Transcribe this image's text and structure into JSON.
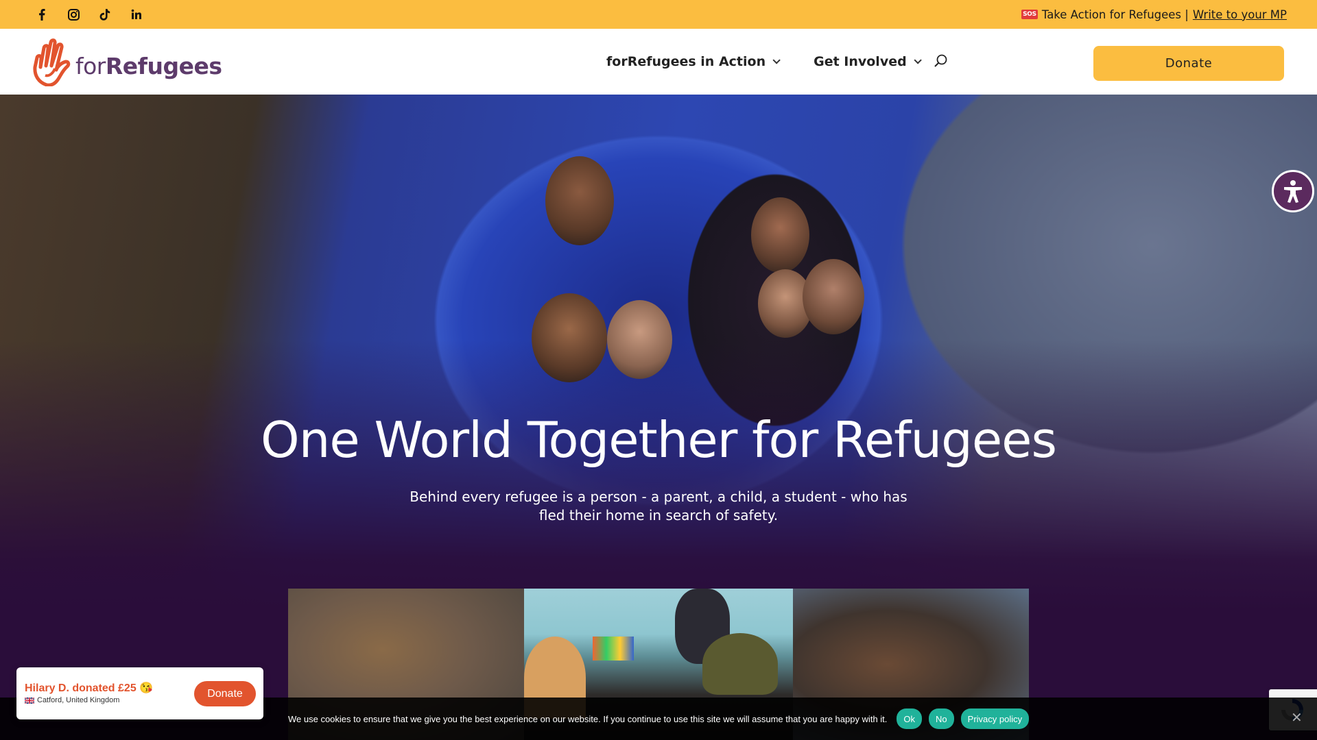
{
  "topbar": {
    "social": [
      "facebook-icon",
      "instagram-icon",
      "tiktok-icon",
      "linkedin-icon"
    ],
    "sos_badge": "SOS",
    "announce_text": "Take Action for Refugees |",
    "announce_link": "Write to your MP"
  },
  "header": {
    "logo_text_a": "for",
    "logo_text_b": "Refugees",
    "nav": [
      {
        "label": "forRefugees in Action"
      },
      {
        "label": "Get Involved"
      }
    ],
    "donate_label": "Donate"
  },
  "hero": {
    "title": "One World Together for Refugees",
    "subtitle": "Behind every refugee is a person - a parent, a child, a student - who has fled their home in search of safety."
  },
  "cookie": {
    "text": "We use cookies to ensure that we give you the best experience on our website. If you continue to use this site we will assume that you are happy with it.",
    "ok_label": "Ok",
    "no_label": "No",
    "policy_label": "Privacy policy"
  },
  "popup": {
    "title": "Hilary D. donated £25 😘",
    "location": "Catford, United Kingdom",
    "button_label": "Donate"
  },
  "colors": {
    "accent_yellow": "#fbbd40",
    "brand_purple": "#5d3b6b",
    "hero_bg": "#2a0d3a",
    "cookie_button": "#20b29a",
    "popup_orange": "#e2542e"
  }
}
